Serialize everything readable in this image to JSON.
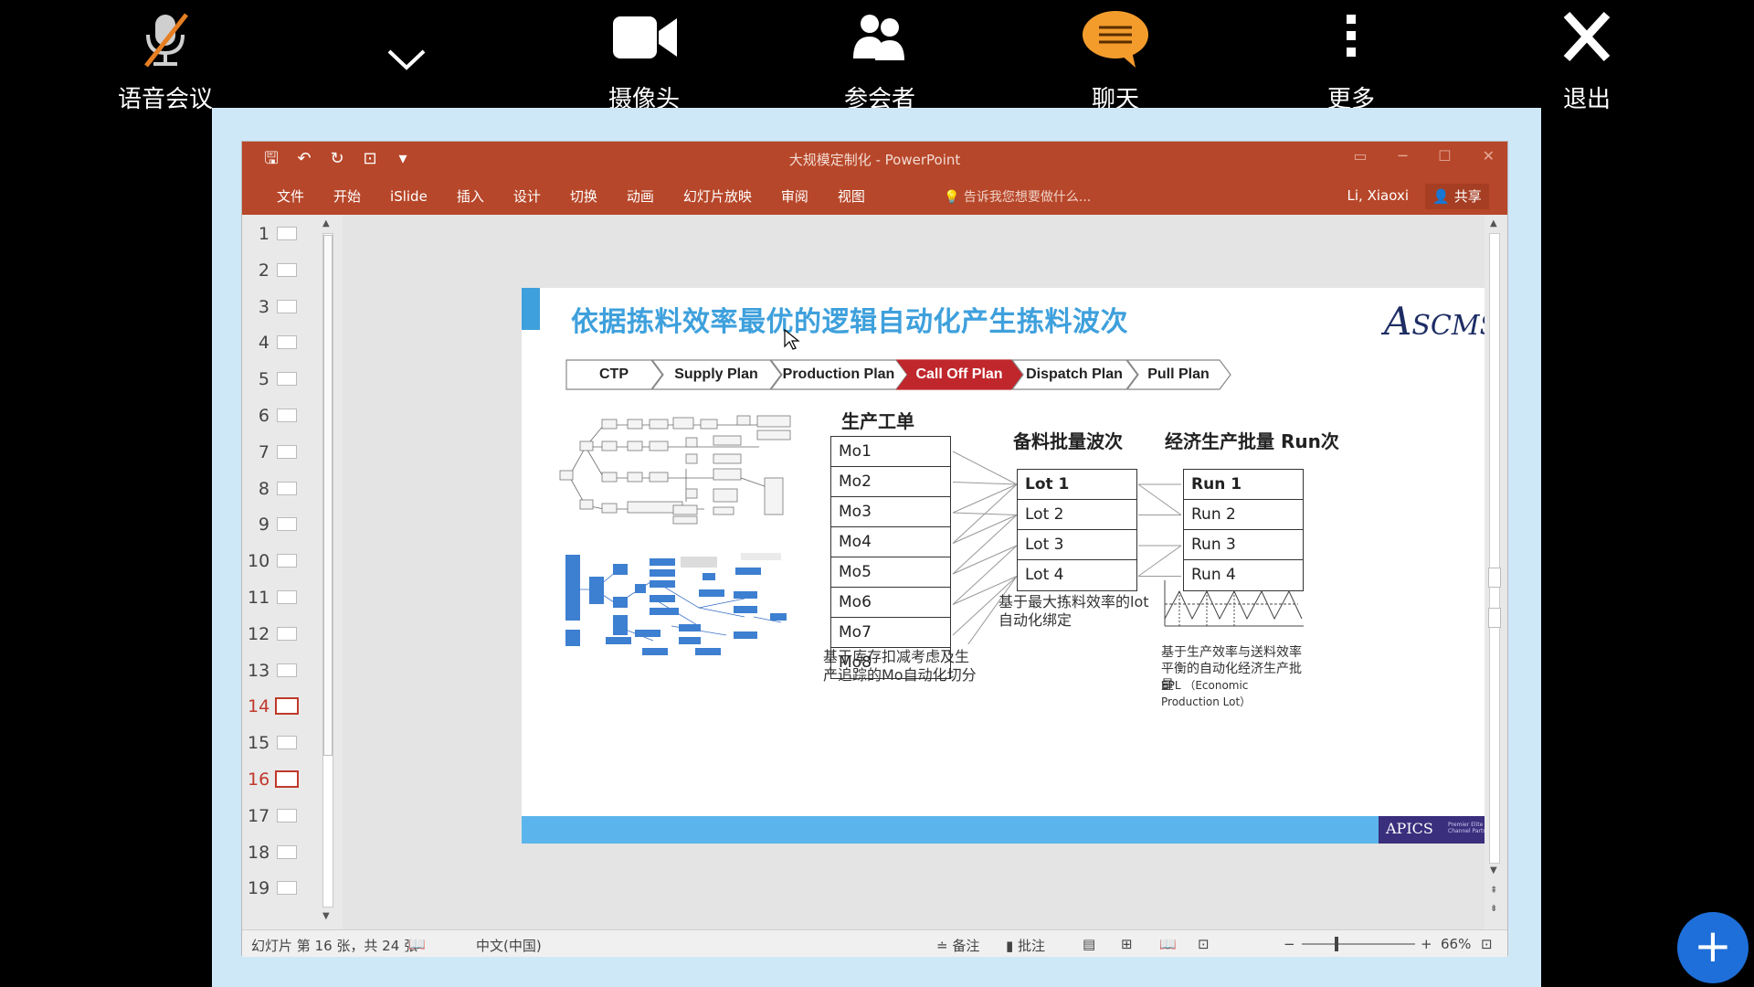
{
  "meeting_bar": {
    "voice": "语音会议",
    "camera": "摄像头",
    "participants": "参会者",
    "chat": "聊天",
    "more": "更多",
    "exit": "退出",
    "colors": {
      "chat_icon": "#f39c2c",
      "mute_slash": "#e67e22"
    }
  },
  "ppt": {
    "title": "大规模定制化 - PowerPoint",
    "tabs": [
      "文件",
      "开始",
      "iSlide",
      "插入",
      "设计",
      "切换",
      "动画",
      "幻灯片放映",
      "审阅",
      "视图"
    ],
    "tell_me": "告诉我您想要做什么...",
    "user": "Li, Xiaoxi",
    "share": "共享",
    "thumbnails": [
      "1",
      "2",
      "3",
      "4",
      "5",
      "6",
      "7",
      "8",
      "9",
      "10",
      "11",
      "12",
      "13",
      "14",
      "15",
      "16",
      "17",
      "18",
      "19"
    ],
    "status": {
      "slide_info": "幻灯片 第 16 张，共 24 张",
      "language": "中文(中国)",
      "notes": "备注",
      "comments": "批注",
      "zoom": "66%"
    },
    "accent": "#b7472a"
  },
  "slide": {
    "title": "依据拣料效率最优的逻辑自动化产生拣料波次",
    "logo_a": "A",
    "logo_rest": "SCMS",
    "flow": [
      "CTP",
      "Supply Plan",
      "Production Plan",
      "Call Off Plan",
      "Dispatch Plan",
      "Pull Plan"
    ],
    "flow_active": "Call Off Plan",
    "mo_header": "生产工单",
    "mo_rows": [
      "Mo1",
      "Mo2",
      "Mo3",
      "Mo4",
      "Mo5",
      "Mo6",
      "Mo7",
      "Mo8"
    ],
    "mo_note": "基于库存扣减考虑及生产追踪的Mo自动化切分",
    "lot_header": "备料批量波次",
    "lot_rows": [
      "Lot 1",
      "Lot 2",
      "Lot 3",
      "Lot 4"
    ],
    "lot_note": "基于最大拣料效率的lot自动化绑定",
    "run_header": "经济生产批量 Run次",
    "run_rows": [
      "Run 1",
      "Run 2",
      "Run 3",
      "Run 4"
    ],
    "run_note": "基于生产效率与送料效率平衡的自动化经济生产批量",
    "run_note2": "EPL （Economic Production Lot）",
    "apics": "APICS",
    "apics_sub": "Premier Elite Channel Partner"
  }
}
